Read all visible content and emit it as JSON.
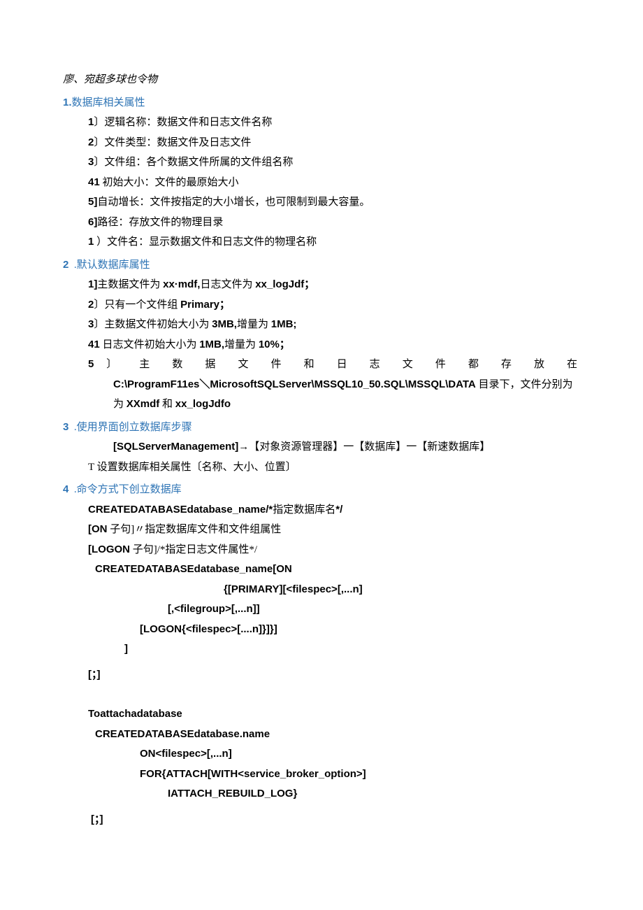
{
  "t0": "廖、宛超多球也令物",
  "s1": {
    "h": "1.",
    "t": "数据库相关属性",
    "i1": {
      "n": "1",
      "s": "〕",
      "t": "逻辑名称：数据文件和日志文件名称"
    },
    "i2": {
      "n": "2",
      "s": "〕",
      "t": "文件类型：数据文件及日志文件"
    },
    "i3": {
      "n": "3",
      "s": "〕",
      "t": "文件组：各个数据文件所属的文件组名称"
    },
    "i4": {
      "n": "41",
      "t": "初始大小：文件的最原始大小"
    },
    "i5": {
      "n": "5]",
      "t": "自动增长：文件按指定的大小增长，也可限制到最大容量。"
    },
    "i6": {
      "n": "6]",
      "t": "路径：存放文件的物理目录"
    },
    "i7": {
      "n": "1",
      "s": "  ）",
      "t": "文件名：显示数据文件和日志文件的物理名称"
    }
  },
  "s2": {
    "h": "2",
    "t": ".默认数据库属性",
    "i1": {
      "n": "1]",
      "a": "主数据文件为",
      "b": "xx·mdf,",
      "c": "日志文件为",
      "d": "xx_logJdf；"
    },
    "i2": {
      "n": "2",
      "s": "〕",
      "a": "只有一个文件组",
      "b": "Primary；"
    },
    "i3": {
      "n": "3",
      "s": "〕",
      "a": "主数据文件初始大小为",
      "b": "3MB,",
      "c": "增量为",
      "d": "1MB;"
    },
    "i4": {
      "n": "41",
      "a": "日志文件初始大小为",
      "b": "1MB,",
      "c": "增量为",
      "d": "10%；"
    },
    "i5": {
      "n": "5",
      "a": "〕 主 数 据 文 件 和 日 志 文 件 都 存 放 在",
      "b": "C:\\ProgramF11es＼MicrosoftSQLServer\\MSSQL10_50.SQL\\MSSQL\\DATA",
      "c": "目录下，文件分别为",
      "d": "XXmdf",
      "e": "和",
      "f": "xx_logJdfo"
    }
  },
  "s3": {
    "h": "3",
    "t": ".使用界面创立数据库步骤",
    "l1": {
      "a": "[SQLServerManagement]",
      "b": "→【对象资源管理器】一【数据库】一【新速数据库】"
    },
    "l2": "T 设置数据库相关属性〔名称、大小、位置〕"
  },
  "s4": {
    "h": "4",
    "t": ".命令方式下创立数据库",
    "l1": {
      "a": "CREATEDATABASEdatabase_name/*",
      "b": "指定数据库名",
      "c": "*/"
    },
    "l2": {
      "a": "[ON",
      "b": "子句",
      "c": "]〃指定数据库文件和文件组属性"
    },
    "l3": {
      "a": "[LOGON",
      "b": "子句",
      "c": "]/*指定日志文件属性*/"
    },
    "c1": "CREATEDATABASEdatabase_name[ON",
    "c2": "{[PRIMARY][<filespec>[,...n]",
    "c3": "[,<filegroup>[,...n]]",
    "c4": "[LOGON{<filespec>[....n]}]}]",
    "c5": "]",
    "c6": "[；]",
    "c7": "Toattachadatabase",
    "c8": "CREATEDATABASEdatabase.name",
    "c9": "ON<filespec>[,...n]",
    "c10": "FOR{ATTACH[WITH<service_broker_option>]",
    "c11": "IATTACH_REBUILD_LOG}",
    "c12": "[；]"
  }
}
